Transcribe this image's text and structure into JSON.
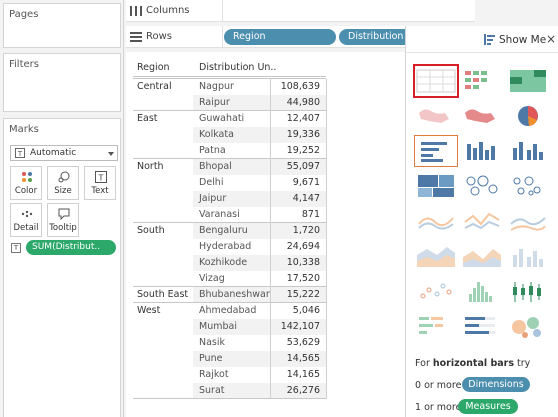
{
  "left": {
    "pages_title": "Pages",
    "filters_title": "Filters",
    "marks_title": "Marks",
    "mark_type": "Automatic",
    "buttons": [
      {
        "label": "Color",
        "icon": "palette-icon"
      },
      {
        "label": "Size",
        "icon": "size-icon"
      },
      {
        "label": "Text",
        "icon": "text-icon"
      },
      {
        "label": "Detail",
        "icon": "detail-icon"
      },
      {
        "label": "Tooltip",
        "icon": "tooltip-icon"
      }
    ],
    "measure_pill": "SUM(Distribut.."
  },
  "shelves": {
    "columns_label": "Columns",
    "rows_label": "Rows",
    "row_pills": [
      "Region",
      "Distribution Unit"
    ]
  },
  "table": {
    "headers": [
      "Region",
      "Distribution Un.."
    ],
    "groups": [
      {
        "region": "Central",
        "rows": [
          [
            "Nagpur",
            "108,639"
          ],
          [
            "Raipur",
            "44,980"
          ]
        ]
      },
      {
        "region": "East",
        "rows": [
          [
            "Guwahati",
            "12,407"
          ],
          [
            "Kolkata",
            "19,336"
          ],
          [
            "Patna",
            "19,252"
          ]
        ]
      },
      {
        "region": "North",
        "rows": [
          [
            "Bhopal",
            "55,097"
          ],
          [
            "Delhi",
            "9,671"
          ],
          [
            "Jaipur",
            "4,147"
          ],
          [
            "Varanasi",
            "871"
          ]
        ]
      },
      {
        "region": "South",
        "rows": [
          [
            "Bengaluru",
            "1,720"
          ],
          [
            "Hyderabad",
            "24,694"
          ],
          [
            "Kozhikode",
            "10,338"
          ],
          [
            "Vizag",
            "17,520"
          ]
        ]
      },
      {
        "region": "South East",
        "rows": [
          [
            "Bhubaneshwar",
            "15,222"
          ]
        ]
      },
      {
        "region": "West",
        "rows": [
          [
            "Ahmedabad",
            "5,046"
          ],
          [
            "Mumbai",
            "142,107"
          ],
          [
            "Nasik",
            "53,629"
          ],
          [
            "Pune",
            "14,565"
          ],
          [
            "Rajkot",
            "14,165"
          ],
          [
            "Surat",
            "26,276"
          ]
        ]
      }
    ]
  },
  "showme": {
    "title": "Show Me",
    "hint_prefix": "For ",
    "hint_bold": "horizontal bars",
    "hint_suffix": " try",
    "dim_prefix": "0 or more",
    "dim_pill": "Dimensions",
    "meas_prefix": "1 or more",
    "meas_pill": "Measures"
  },
  "colors": {
    "blue_pill": "#4c8eae",
    "green_pill": "#2ba86a",
    "selected_outline": "#d81f26"
  }
}
